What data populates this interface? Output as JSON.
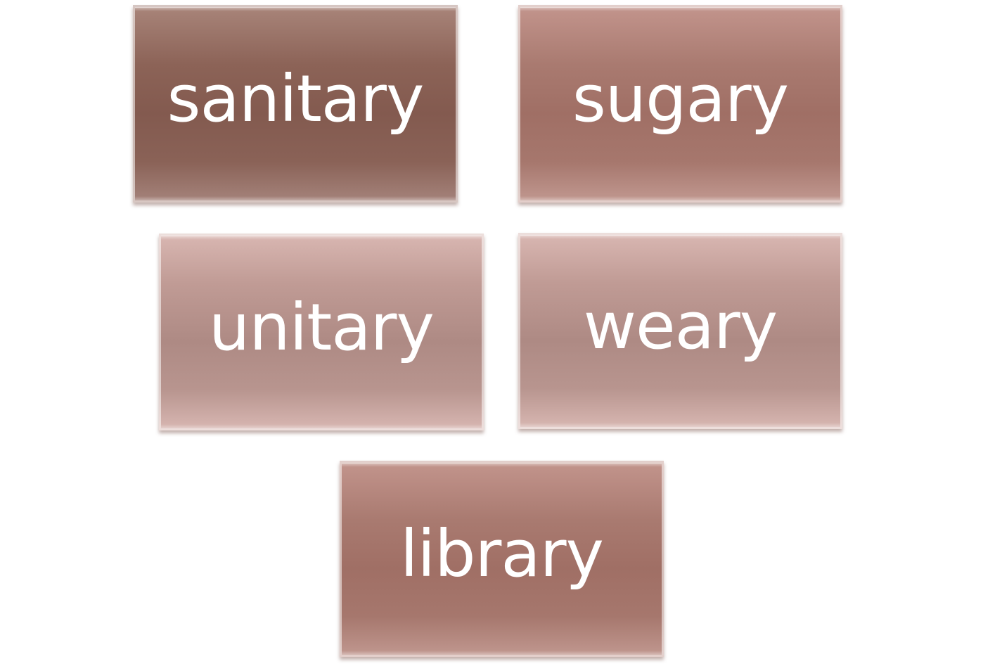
{
  "tiles": [
    {
      "label": "sanitary",
      "color": "#8c6357"
    },
    {
      "label": "sugary",
      "color": "#a97a70"
    },
    {
      "label": "unitary",
      "color": "#b8958f"
    },
    {
      "label": "weary",
      "color": "#b8958f"
    },
    {
      "label": "library",
      "color": "#a97a70"
    }
  ]
}
